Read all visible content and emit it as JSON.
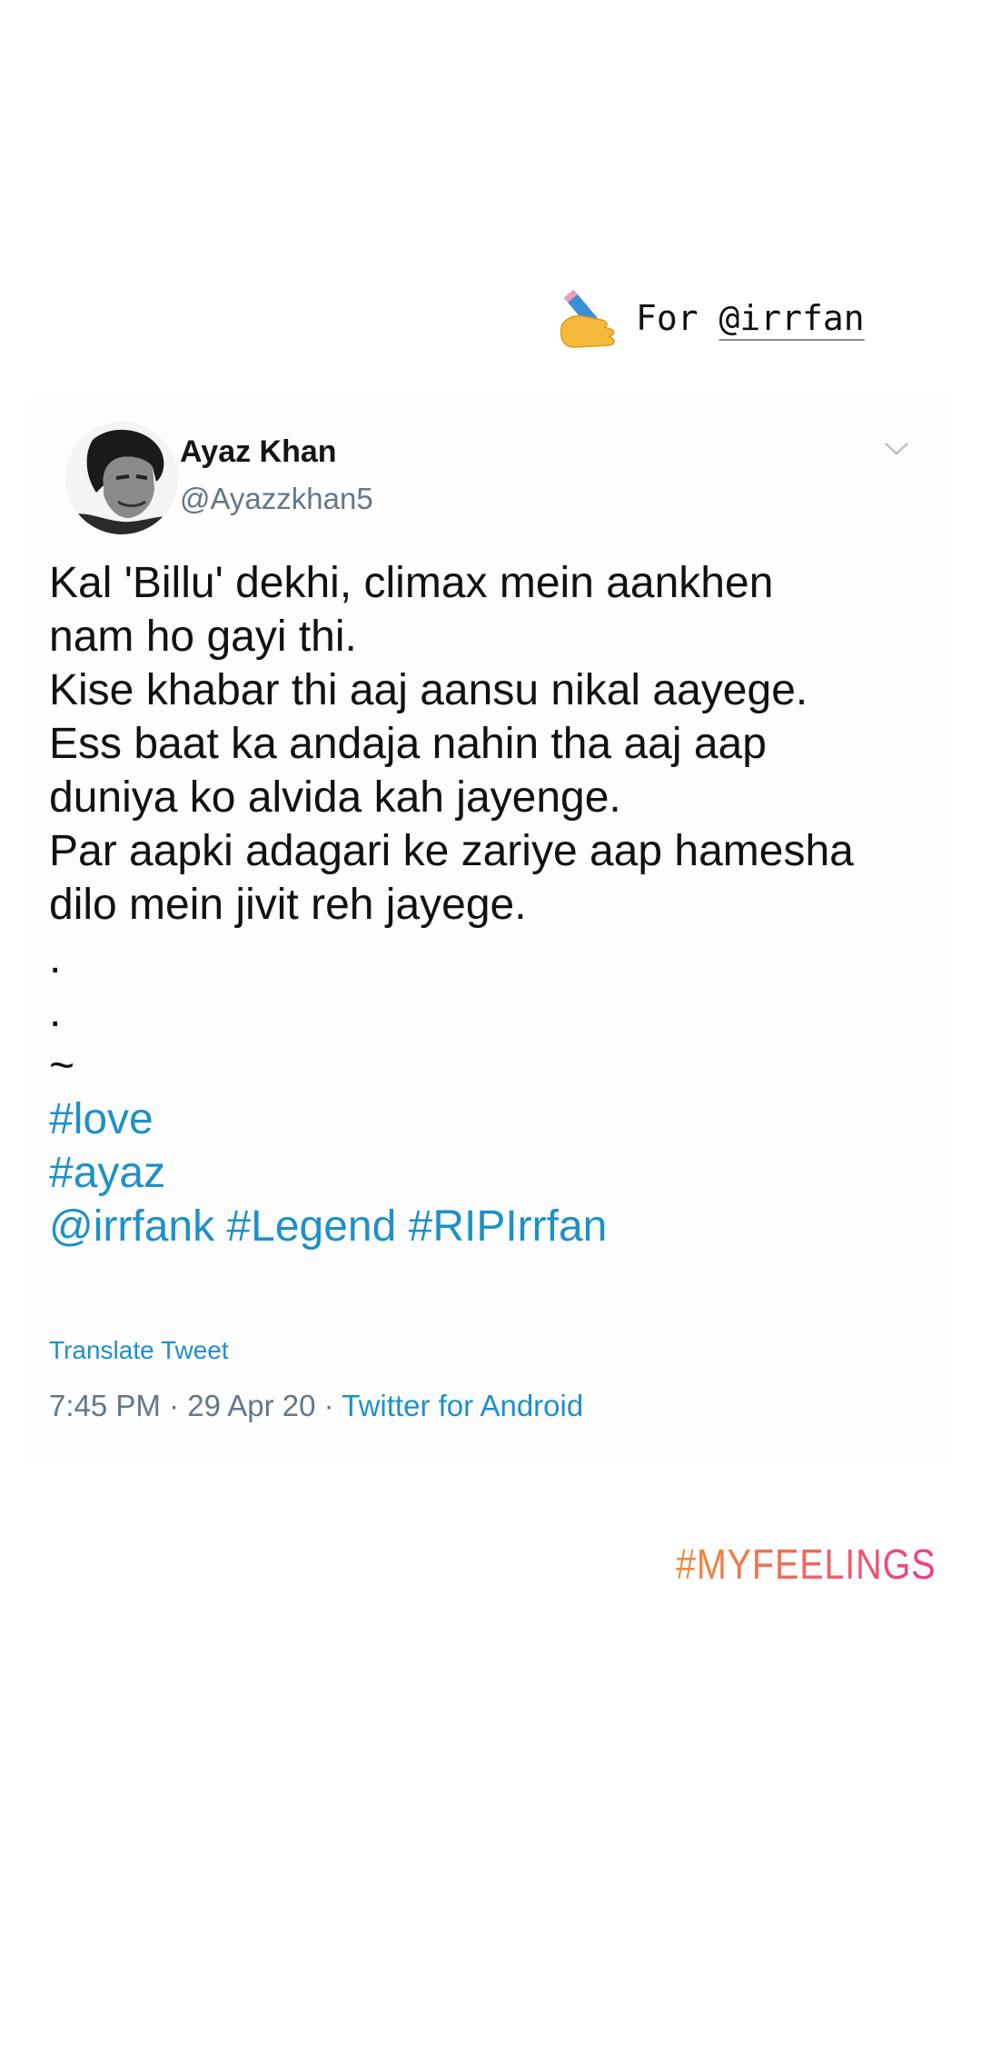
{
  "story": {
    "caption_prefix": "For ",
    "caption_mention": "@irrfan",
    "caption_icon": "writing-hand-emoji",
    "hashtag_sticker": "#MYFEELINGS",
    "hashtag_gradient": [
      "#f08a3a",
      "#e8408a"
    ]
  },
  "tweet": {
    "author": {
      "name": "Ayaz Khan",
      "handle": "@Ayazzkhan5"
    },
    "menu_icon": "chevron-down-icon",
    "text_lines": [
      "Kal 'Billu' dekhi, climax mein aankhen",
      "nam ho gayi thi.",
      "Kise khabar thi aaj aansu nikal aayege.",
      "Ess baat ka andaja nahin tha aaj aap",
      "duniya ko alvida kah jayenge.",
      "Par aapki adagari ke zariye aap hamesha",
      "dilo mein jivit reh jayege."
    ],
    "spacer_lines": [
      ".",
      ".",
      "~"
    ],
    "hashtag_lines": [
      "#love",
      "#ayaz",
      "@irrfank #Legend #RIPIrrfan"
    ],
    "translate_label": "Translate Tweet",
    "time": "7:45 PM",
    "date": "29 Apr 20",
    "separator": " · ",
    "source": "Twitter for Android",
    "link_color": "#1e90c8"
  }
}
